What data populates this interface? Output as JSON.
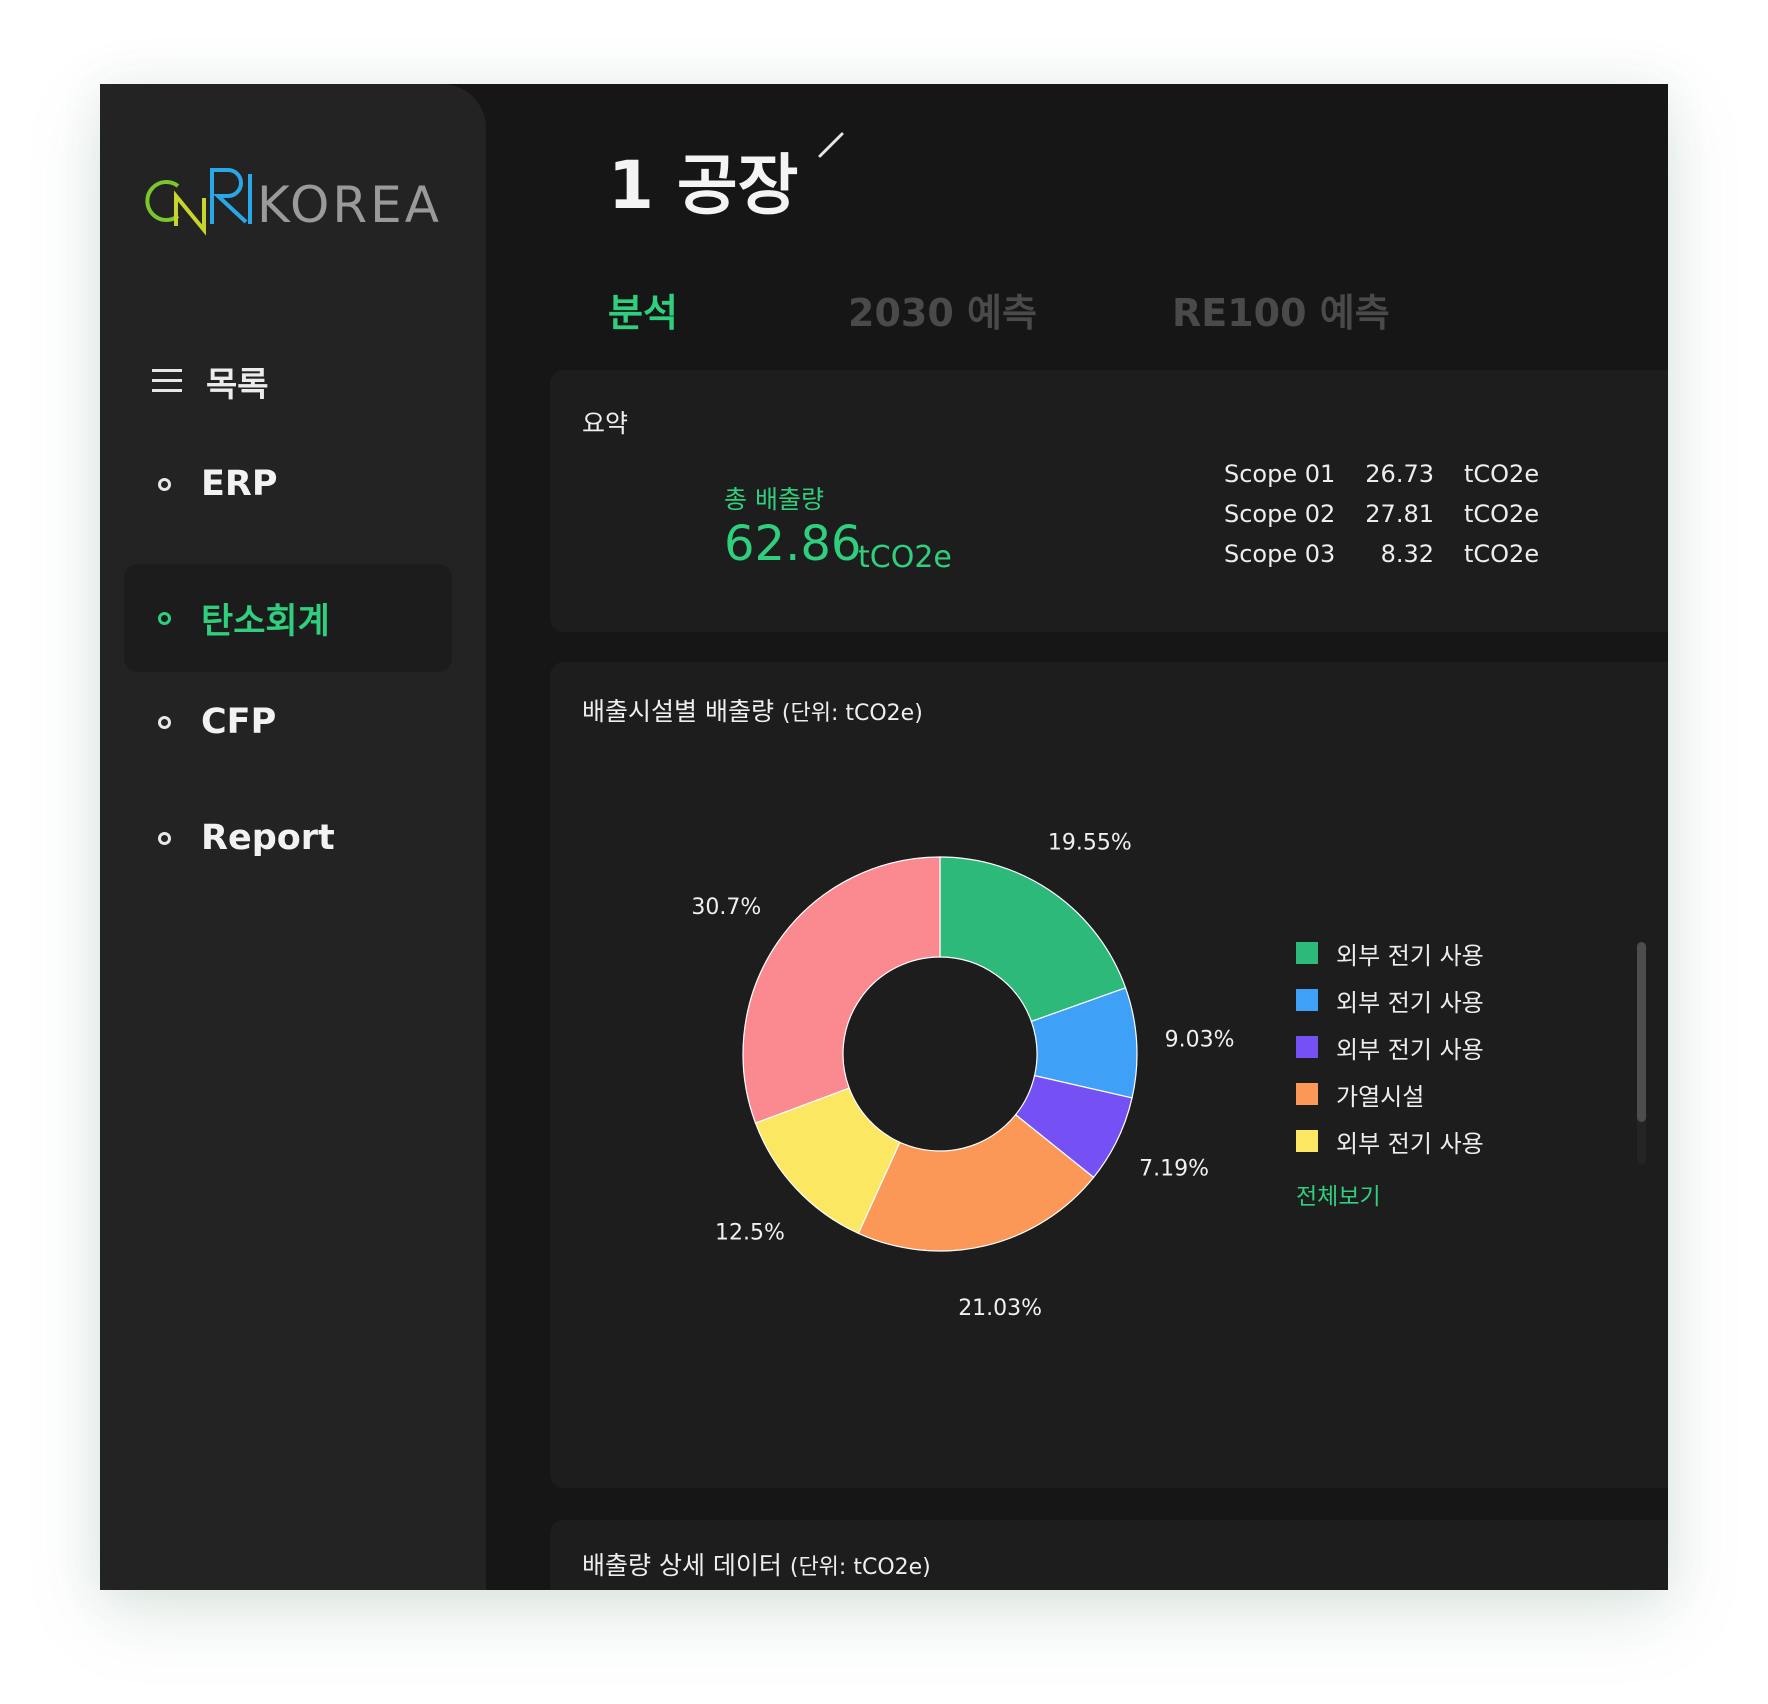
{
  "sidebar": {
    "logo_text": "KOREA",
    "logo_letters": "CNR",
    "menu_label": "목록",
    "items": [
      {
        "label": "ERP",
        "active": false
      },
      {
        "label": "탄소회계",
        "active": true
      },
      {
        "label": "CFP",
        "active": false
      },
      {
        "label": "Report",
        "active": false
      }
    ]
  },
  "header": {
    "title": "1 공장",
    "tabs": [
      {
        "label": "분석",
        "active": true
      },
      {
        "label": "2030 예측",
        "active": false
      },
      {
        "label": "RE100 예측",
        "active": false
      }
    ]
  },
  "summary": {
    "title": "요약",
    "total_label": "총 배출량",
    "total_value": "62.86",
    "total_unit": "tCO2e",
    "scopes": [
      {
        "name": "Scope 01",
        "value": "26.73",
        "unit": "tCO2e"
      },
      {
        "name": "Scope 02",
        "value": "27.81",
        "unit": "tCO2e"
      },
      {
        "name": "Scope 03",
        "value": "8.32",
        "unit": "tCO2e"
      }
    ]
  },
  "facility_chart": {
    "title": "배출시설별 배출량",
    "unit_note": "(단위: tCO2e)",
    "view_all": "전체보기"
  },
  "detail": {
    "title": "배출량 상세 데이터",
    "unit_note": "(단위: tCO2e)"
  },
  "colors": {
    "accent": "#2fcf7d",
    "sidebar_bg": "#232323",
    "page_bg": "#161616",
    "card_bg": "#1d1d1d"
  },
  "icons": [
    "menu-icon",
    "edit-pencil-icon",
    "nav-dot-icon"
  ],
  "chart_data": {
    "type": "pie",
    "donut": true,
    "slices": [
      {
        "label": "외부 전기 사용",
        "value": 19.55,
        "value_label": "19.55%",
        "color": "#2cb97a"
      },
      {
        "label": "외부 전기 사용",
        "value": 9.03,
        "value_label": "9.03%",
        "color": "#3fa0f7"
      },
      {
        "label": "외부 전기 사용",
        "value": 7.19,
        "value_label": "7.19%",
        "color": "#7551f5"
      },
      {
        "label": "가열시설",
        "value": 21.03,
        "value_label": "21.03%",
        "color": "#fb9757"
      },
      {
        "label": "외부 전기 사용",
        "value": 12.5,
        "value_label": "12.5%",
        "color": "#fbe762"
      },
      {
        "label": "",
        "value": 30.7,
        "value_label": "30.7%",
        "color": "#fb8990"
      }
    ],
    "legend": [
      {
        "label": "외부 전기 사용",
        "color": "#2cb97a"
      },
      {
        "label": "외부 전기 사용",
        "color": "#3fa0f7"
      },
      {
        "label": "외부 전기 사용",
        "color": "#7551f5"
      },
      {
        "label": "가열시설",
        "color": "#fb9757"
      },
      {
        "label": "외부 전기 사용",
        "color": "#fbe762"
      }
    ],
    "legend_position": "right"
  }
}
